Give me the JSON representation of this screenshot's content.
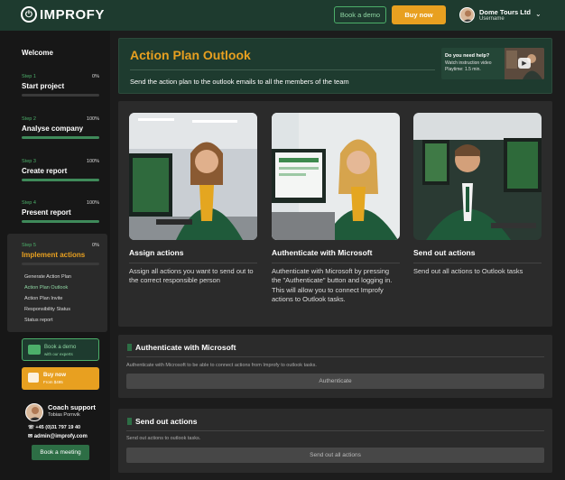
{
  "header": {
    "logo_text": "IMPROFY",
    "logo_icon": "power-icon",
    "demo_label": "Book a demo",
    "buy_label": "Buy now",
    "user_name": "Dome Tours Ltd",
    "user_sub": "Username"
  },
  "sidebar": {
    "welcome": "Welcome",
    "steps": [
      {
        "num": "Step 1",
        "title": "Start project",
        "pct": "0%",
        "progress": 0
      },
      {
        "num": "Step 2",
        "title": "Analyse company",
        "pct": "100%",
        "progress": 1
      },
      {
        "num": "Step 3",
        "title": "Create report",
        "pct": "100%",
        "progress": 1
      },
      {
        "num": "Step 4",
        "title": "Present report",
        "pct": "100%",
        "progress": 1
      },
      {
        "num": "Step 5",
        "title": "Implement actions",
        "pct": "0%",
        "progress": 0
      }
    ],
    "substeps": [
      "Generate Action Plan",
      "Action Plan Outlook",
      "Action Plan Invite",
      "Responsibility Status",
      "Status report"
    ],
    "demo_l1": "Book a demo",
    "demo_l2": "with our experts",
    "buy_l1": "Buy now",
    "buy_l2": "From $495",
    "coach_title": "Coach support",
    "coach_name": "Tobias Pornvik",
    "coach_phone": "+45 (0)31 797 19 40",
    "coach_mail": "admin@improfy.com",
    "meeting_label": "Book a meeting"
  },
  "main": {
    "title": "Action Plan Outlook",
    "description": "Send the action plan to the outlook emails to all the members of the team",
    "help": {
      "l1": "Do you need help?",
      "l2": "Watch instruction video",
      "l3": "Playtime: 1.5 min."
    },
    "cards": [
      {
        "title": "Assign actions",
        "text": "Assign all actions you want to send out to the correct responsible person"
      },
      {
        "title": "Authenticate with Microsoft",
        "text": "Authenticate with Microsoft by pressing the \"Authenticate\" button and logging in. This will allow you to connect Improfy actions to Outlook tasks."
      },
      {
        "title": "Send out actions",
        "text": "Send out all actions to Outlook tasks"
      }
    ],
    "auth_section": {
      "title": "Authenticate with Microsoft",
      "desc": "Authenticate with Microsoft to be able to connect actions from Improfy to outlook tasks.",
      "button": "Authenticate"
    },
    "send_section": {
      "title": "Send out actions",
      "desc": "Send out actions to outlook tasks.",
      "button": "Send out all actions"
    }
  },
  "colors": {
    "brand_green": "#1e3b2f",
    "accent_orange": "#e8a020",
    "step_green": "#4caf6a"
  }
}
